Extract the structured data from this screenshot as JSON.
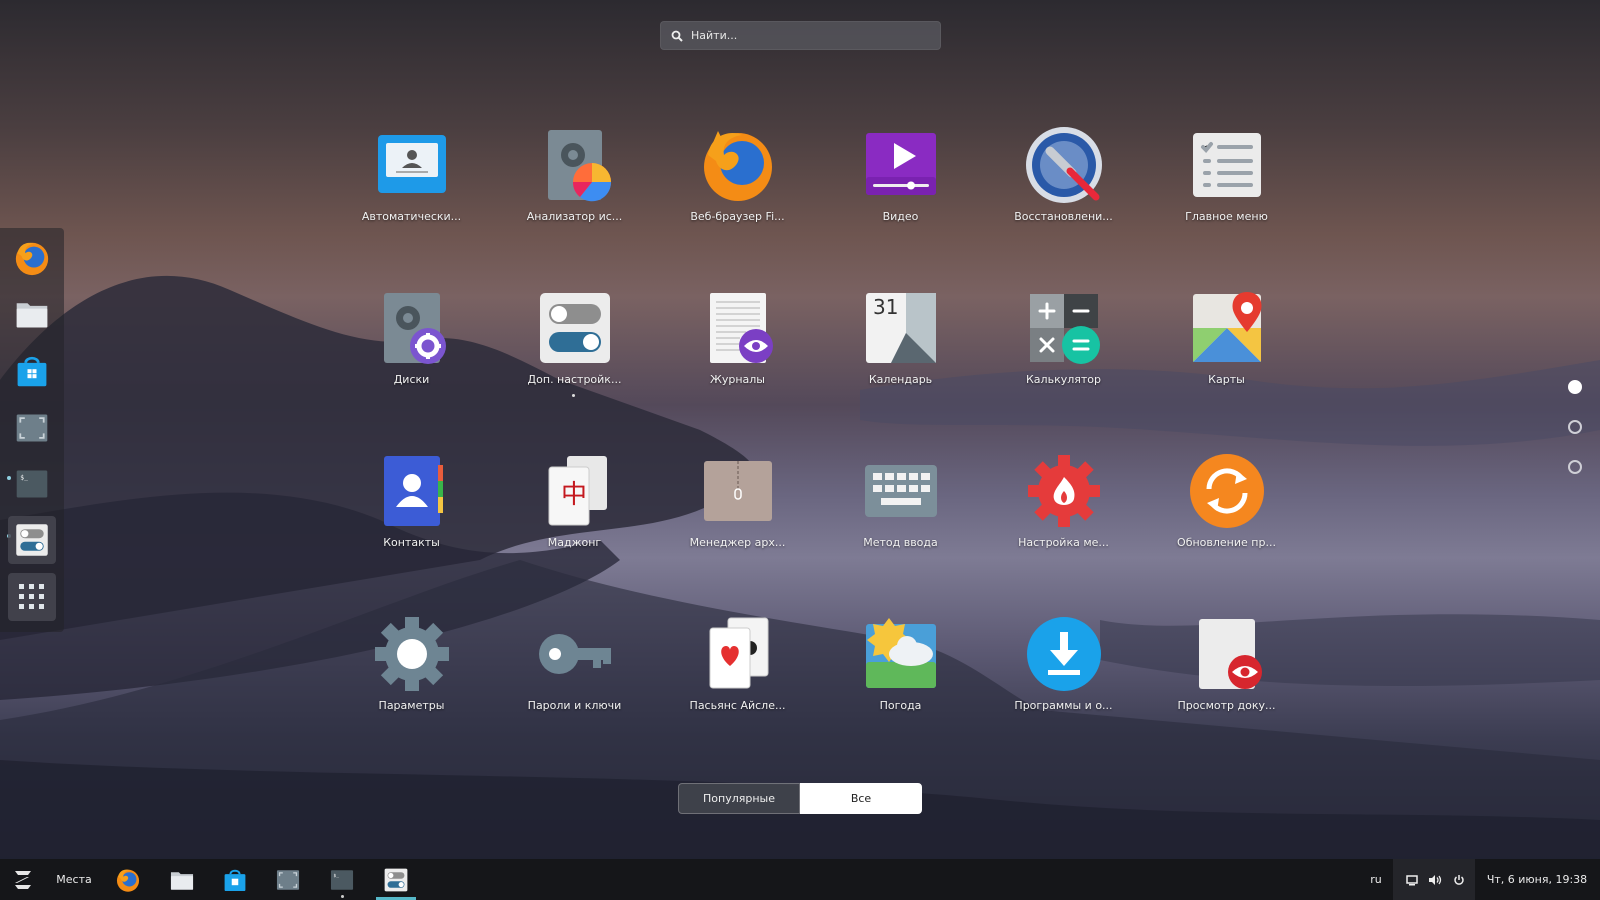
{
  "search": {
    "placeholder": "Найти..."
  },
  "apps": [
    {
      "label": "Автоматически...",
      "icon": "contacts-card-icon"
    },
    {
      "label": "Анализатор ис...",
      "icon": "disk-usage-analyzer-icon"
    },
    {
      "label": "Веб-браузер Fi...",
      "icon": "firefox-icon"
    },
    {
      "label": "Видео",
      "icon": "video-player-icon"
    },
    {
      "label": "Восстановлени...",
      "icon": "repair-tool-icon"
    },
    {
      "label": "Главное меню",
      "icon": "main-menu-checklist-icon"
    },
    {
      "label": "Диски",
      "icon": "disks-icon"
    },
    {
      "label": "Доп. настройк...",
      "icon": "tweaks-toggles-icon"
    },
    {
      "label": "Журналы",
      "icon": "logs-icon"
    },
    {
      "label": "Календарь",
      "icon": "calendar-icon"
    },
    {
      "label": "Калькулятор",
      "icon": "calculator-icon"
    },
    {
      "label": "Карты",
      "icon": "maps-icon"
    },
    {
      "label": "Контакты",
      "icon": "contacts-icon"
    },
    {
      "label": "Маджонг",
      "icon": "mahjongg-icon"
    },
    {
      "label": "Менеджер арх...",
      "icon": "archive-manager-icon"
    },
    {
      "label": "Метод ввода",
      "icon": "keyboard-icon"
    },
    {
      "label": "Настройка ме...",
      "icon": "menu-settings-gear-icon"
    },
    {
      "label": "Обновление пр...",
      "icon": "software-update-icon"
    },
    {
      "label": "Параметры",
      "icon": "settings-gear-icon"
    },
    {
      "label": "Пароли и ключи",
      "icon": "key-icon"
    },
    {
      "label": "Пасьянс Айсле...",
      "icon": "solitaire-cards-icon"
    },
    {
      "label": "Погода",
      "icon": "weather-icon"
    },
    {
      "label": "Программы и о...",
      "icon": "software-download-icon"
    },
    {
      "label": "Просмотр доку...",
      "icon": "document-viewer-icon"
    }
  ],
  "dock": [
    "firefox-icon",
    "files-folder-icon",
    "software-store-icon",
    "screenshot-icon",
    "terminal-icon",
    "tweaks-icon",
    "app-grid-icon"
  ],
  "tabs": {
    "popular": "Популярные",
    "all": "Все"
  },
  "taskbar": {
    "places": "Места",
    "lang": "ru",
    "datetime": "Чт, 6 июня, 19:38"
  },
  "colors": {
    "accent": "#56b8c8",
    "taskbar": "#151619"
  }
}
